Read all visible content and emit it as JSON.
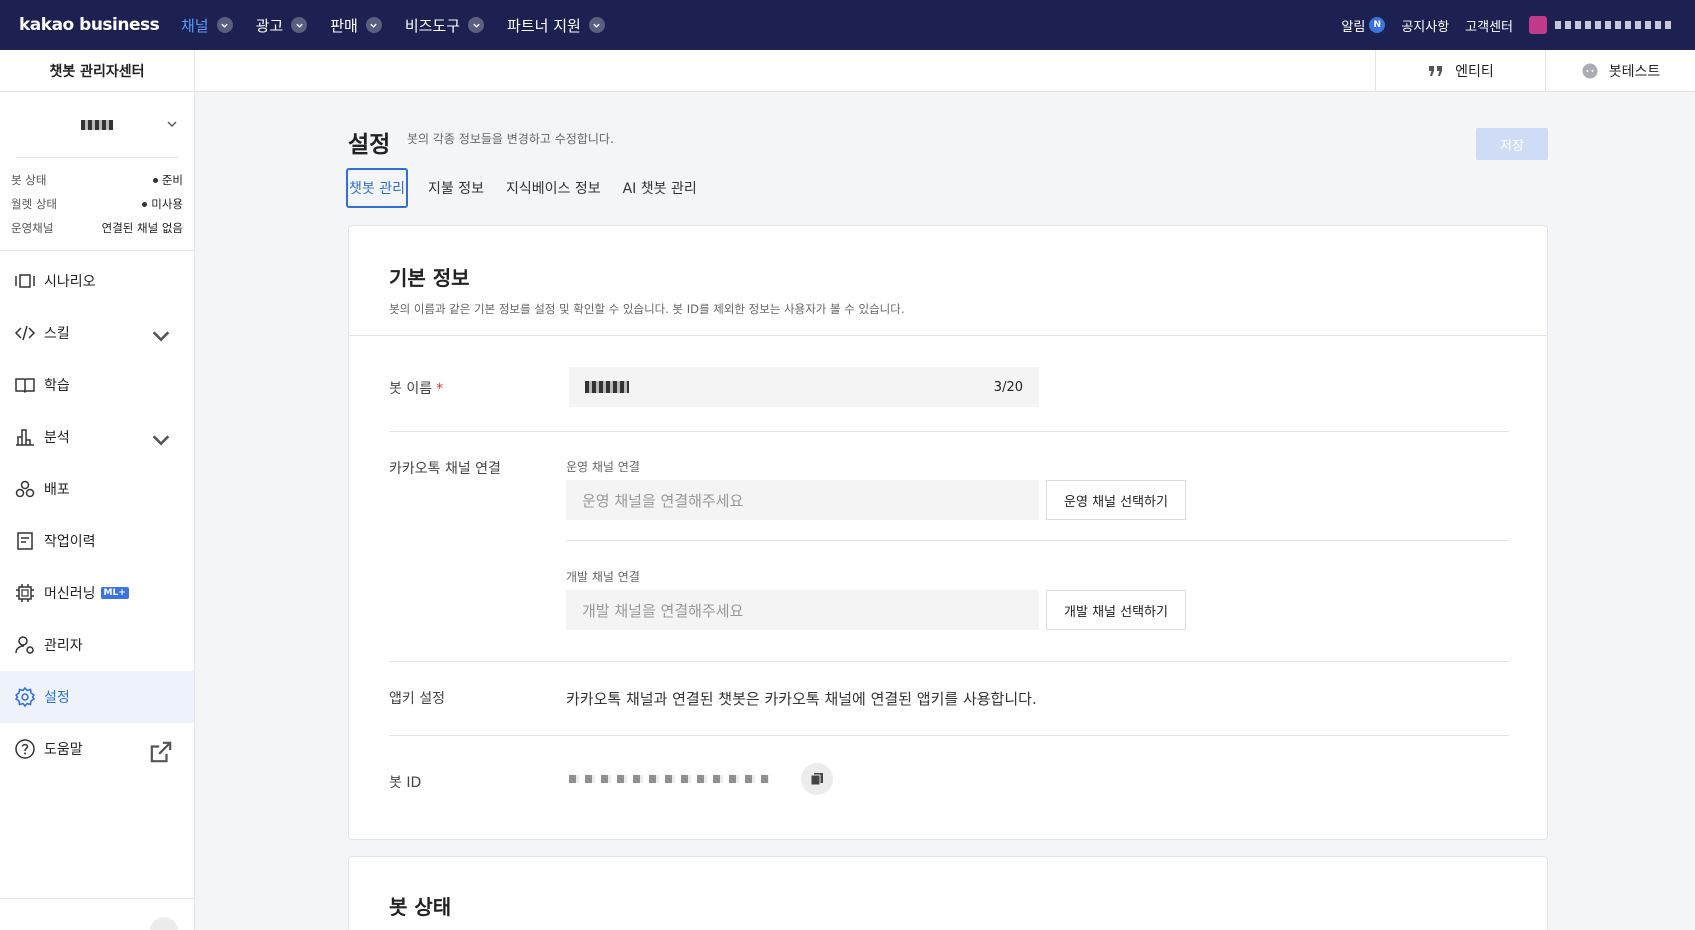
{
  "topnav": {
    "logo": "kakao business",
    "menu": [
      {
        "label": "채널",
        "active": true
      },
      {
        "label": "광고"
      },
      {
        "label": "판매"
      },
      {
        "label": "비즈도구"
      },
      {
        "label": "파트너 지원"
      }
    ],
    "alarm_label": "알림",
    "alarm_badge": "N",
    "notice_label": "공지사항",
    "support_label": "고객센터"
  },
  "sidebar": {
    "title": "챗봇 관리자센터",
    "status": [
      {
        "label": "봇 상태",
        "value": "준비",
        "dot": true
      },
      {
        "label": "월렛 상태",
        "value": "미사용",
        "dot": true
      },
      {
        "label": "운영채널",
        "value": "연결된 채널 없음",
        "dot": false
      }
    ],
    "items": [
      {
        "label": "시나리오",
        "icon": "scenario-icon"
      },
      {
        "label": "스킬",
        "icon": "code-icon",
        "expandable": true
      },
      {
        "label": "학습",
        "icon": "book-icon"
      },
      {
        "label": "분석",
        "icon": "chart-icon",
        "expandable": true
      },
      {
        "label": "배포",
        "icon": "deploy-icon"
      },
      {
        "label": "작업이력",
        "icon": "history-icon"
      },
      {
        "label": "머신러닝",
        "icon": "chip-icon",
        "badge": "ML+"
      },
      {
        "label": "관리자",
        "icon": "user-gear-icon"
      },
      {
        "label": "설정",
        "icon": "gear-icon",
        "active": true
      },
      {
        "label": "도움말",
        "icon": "help-icon",
        "external": true
      }
    ]
  },
  "subheader": {
    "entity_label": "엔티티",
    "bottest_label": "봇테스트"
  },
  "page": {
    "title": "설정",
    "description": "봇의 각종 정보들을 변경하고 수정합니다.",
    "save_label": "저장",
    "tabs": [
      "챗봇 관리",
      "지불 정보",
      "지식베이스 정보",
      "AI 챗봇 관리"
    ]
  },
  "basic_info": {
    "title": "기본 정보",
    "description": "봇의 이름과 같은 기본 정보를 설정 및 확인할 수 있습니다. 봇 ID를 제외한 정보는 사용자가 볼 수 있습니다.",
    "bot_name_label": "봇 이름",
    "bot_name_required": "*",
    "bot_name_counter": "3/20",
    "kakao_channel_label": "카카오톡 채널 연결",
    "op_channel_label": "운영 채널 연결",
    "op_channel_placeholder": "운영 채널을 연결해주세요",
    "op_channel_button": "운영 채널 선택하기",
    "dev_channel_label": "개발 채널 연결",
    "dev_channel_placeholder": "개발 채널을 연결해주세요",
    "dev_channel_button": "개발 채널 선택하기",
    "appkey_label": "앱키 설정",
    "appkey_notice": "카카오톡 채널과 연결된 챗봇은 카카오톡 채널에 연결된 앱키를 사용합니다.",
    "bot_id_label": "봇 ID"
  },
  "bot_status": {
    "title": "봇 상태"
  }
}
